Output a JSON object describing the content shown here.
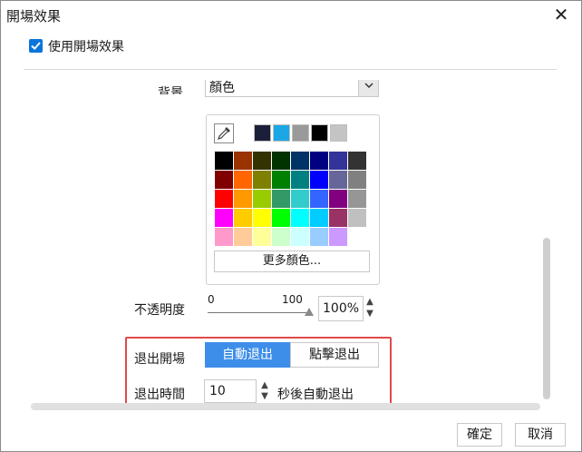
{
  "window": {
    "title": "開場效果",
    "close_icon": "close-icon"
  },
  "enable": {
    "label": "使用開場效果",
    "checked": true
  },
  "background": {
    "label": "背景",
    "value": "顏色"
  },
  "color_picker": {
    "recent_colors": [
      "#1c1f3a",
      "#1ba7e6",
      "#9a9a9a",
      "#000000",
      "#c4c4c4"
    ],
    "grid": [
      [
        "#000000",
        "#993300",
        "#333300",
        "#003300",
        "#003366",
        "#000080",
        "#333399",
        "#333333"
      ],
      [
        "#800000",
        "#ff6600",
        "#808000",
        "#008000",
        "#008080",
        "#0000ff",
        "#666699",
        "#808080"
      ],
      [
        "#ff0000",
        "#ff9900",
        "#99cc00",
        "#339966",
        "#33cccc",
        "#3366ff",
        "#800080",
        "#969696"
      ],
      [
        "#ff00ff",
        "#ffcc00",
        "#ffff00",
        "#00ff00",
        "#00ffff",
        "#00ccff",
        "#993366",
        "#c0c0c0"
      ],
      [
        "#ff99cc",
        "#ffcc99",
        "#ffff99",
        "#ccffcc",
        "#ccffff",
        "#99ccff",
        "#cc99ff",
        "#ffffff"
      ]
    ],
    "more_colors_label": "更多顏色..."
  },
  "opacity": {
    "label": "不透明度",
    "min_label": "0",
    "max_label": "100",
    "value": "100%",
    "level": 1.0
  },
  "exit": {
    "label": "退出開場",
    "options": [
      "自動退出",
      "點擊退出"
    ],
    "selected": "自動退出"
  },
  "exit_time": {
    "label": "退出時間",
    "value": "10",
    "suffix": "秒後自動退出"
  },
  "buttons": {
    "ok": "確定",
    "cancel": "取消"
  },
  "colors": {
    "accent": "#3d8ee8",
    "checkbox": "#0a74da",
    "highlight": "#e04a4a"
  }
}
